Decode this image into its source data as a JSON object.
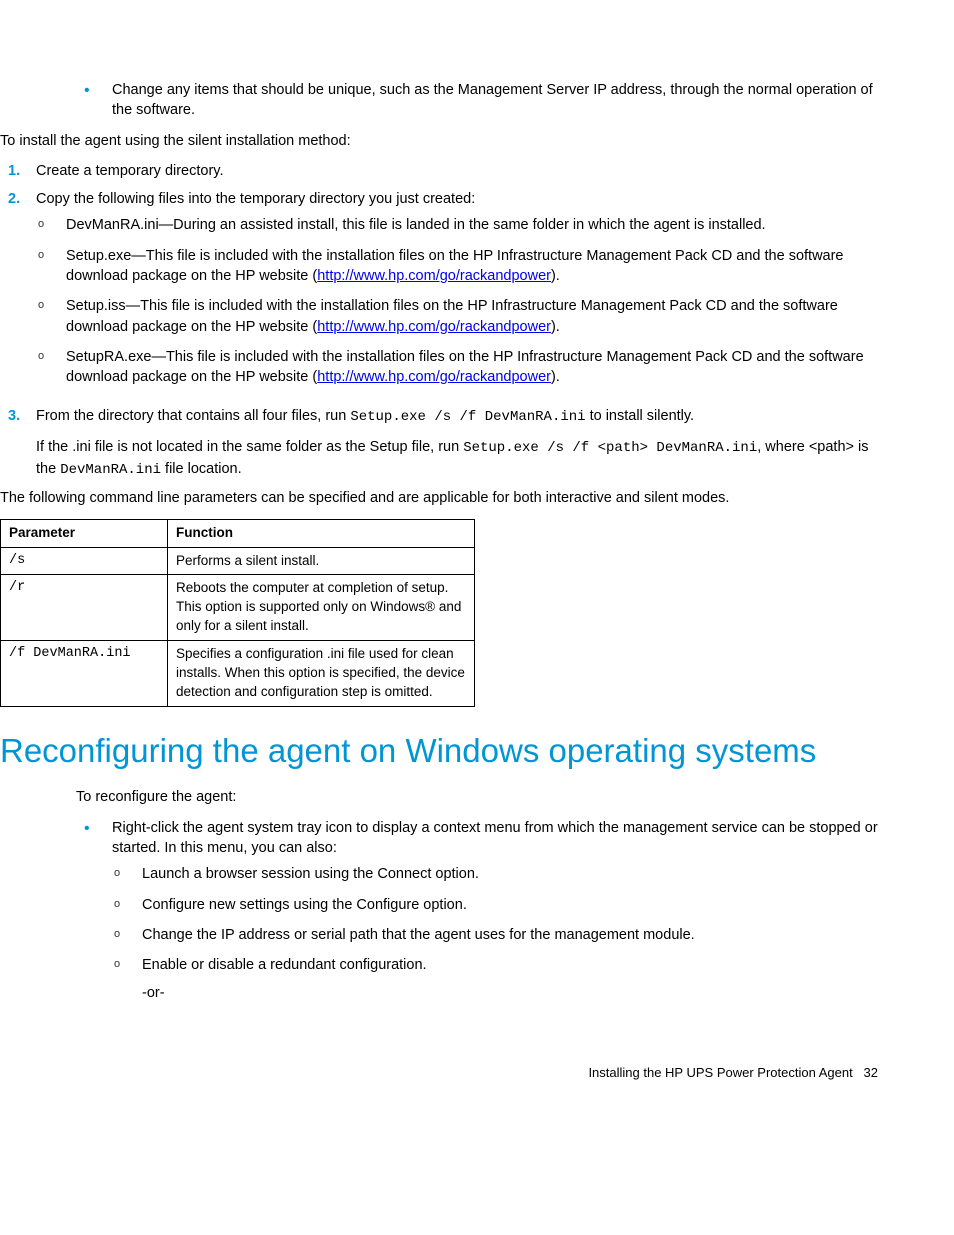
{
  "top_bullet": "Change any items that should be unique, such as the Management Server IP address, through the normal operation of the software.",
  "intro_line": "To install the agent using the silent installation method:",
  "step1": "Create a temporary directory.",
  "step2": "Copy the following files into the temporary directory you just created:",
  "sub2a": "DevManRA.ini—During an assisted install, this file is landed in the same folder in which the agent is installed.",
  "sub2b_pre": "Setup.exe—This file is included with the installation files on the HP Infrastructure Management Pack CD and the software download package on the HP website (",
  "link_text": "http://www.hp.com/go/rackandpower",
  "link_close": ").",
  "sub2c_pre": "Setup.iss—This file is included with the installation files on the HP Infrastructure Management Pack CD and the software download package on the HP website (",
  "sub2d_pre": "SetupRA.exe—This file is included with the installation files on the HP Infrastructure Management Pack CD and the software download package on the HP website (",
  "step3_a": "From the directory that contains all four files, run ",
  "step3_cmd": "Setup.exe /s /f DevManRA.ini",
  "step3_b": " to install silently.",
  "step3_p2_a": "If the .ini file is not located in the same folder as the Setup file, run ",
  "step3_p2_cmd": "Setup.exe /s /f <path> DevManRA.ini",
  "step3_p2_b": ", where <path> is the ",
  "step3_p2_cmd2": "DevManRA.ini",
  "step3_p2_c": " file location.",
  "table_intro": "The following command line parameters can be specified and are applicable for both interactive and silent modes.",
  "th_param": "Parameter",
  "th_func": "Function",
  "r1_p": "/s",
  "r1_f": "Performs a silent install.",
  "r2_p": "/r",
  "r2_f": "Reboots the computer at completion of setup. This option is supported only on Windows® and only for a silent install.",
  "r3_p": "/f DevManRA.ini",
  "r3_f": "Specifies a configuration .ini file used for clean installs. When this option is specified, the device detection and configuration step is omitted.",
  "heading": "Reconfiguring the agent on Windows operating systems",
  "reconf_intro": "To reconfigure the agent:",
  "reconf_bullet": "Right-click the agent system tray icon to display a context menu from which the management service can be stopped or started. In this menu, you can also:",
  "rc_a": "Launch a browser session using the Connect option.",
  "rc_b": "Configure new settings using the Configure option.",
  "rc_c": "Change the IP address or serial path that the agent uses for the management module.",
  "rc_d": "Enable or disable a redundant configuration.",
  "rc_or": "-or-",
  "footer_text": "Installing the HP UPS Power Protection Agent",
  "footer_page": "32",
  "markers": {
    "o": "o",
    "bullet": "•",
    "n1": "1.",
    "n2": "2.",
    "n3": "3."
  }
}
